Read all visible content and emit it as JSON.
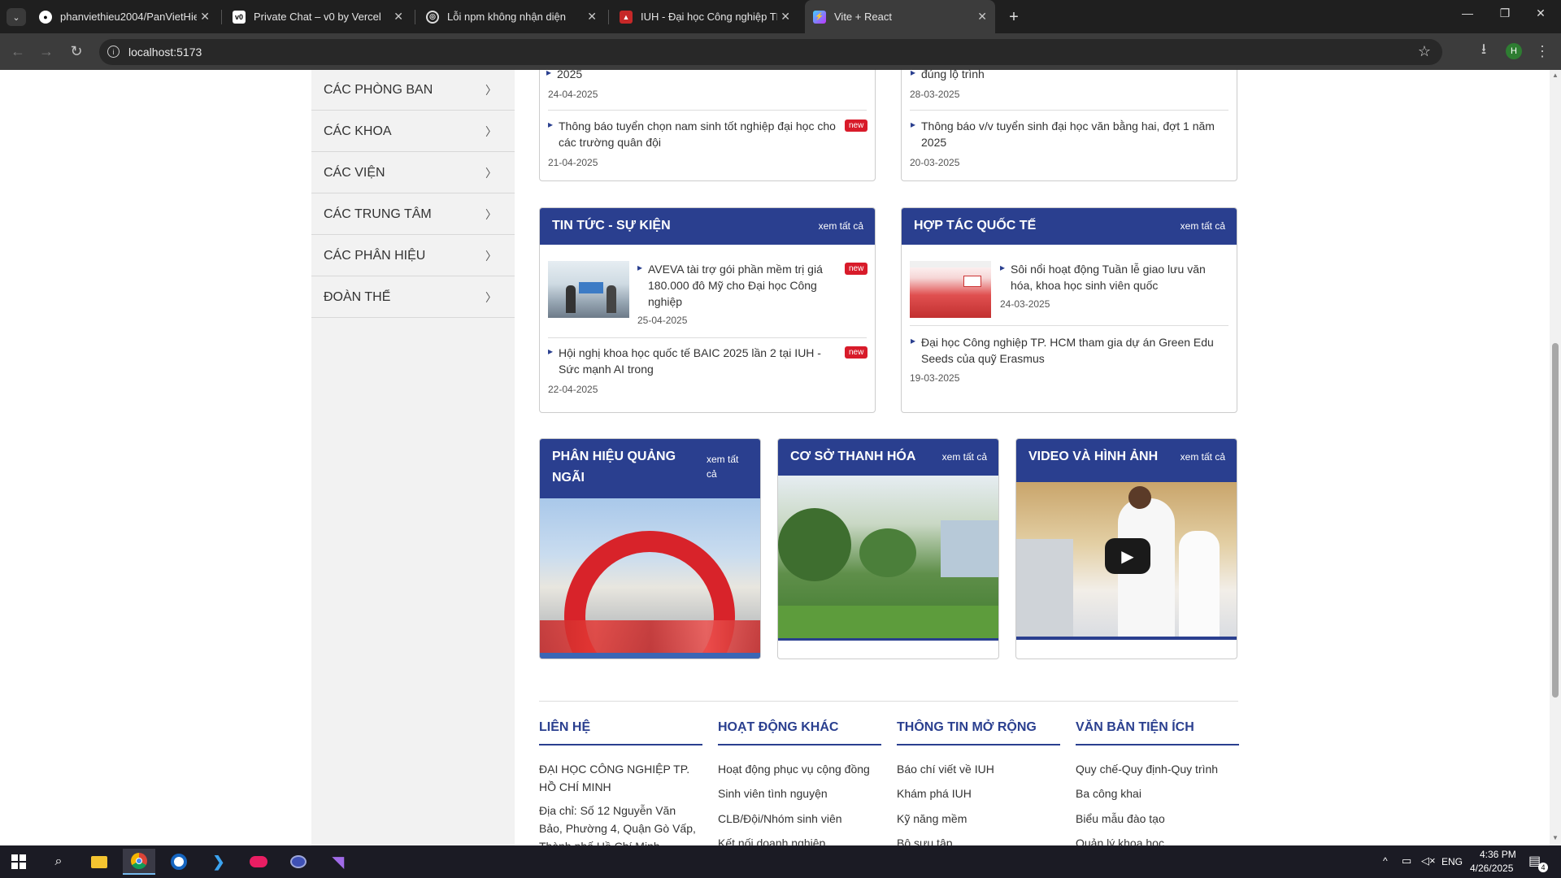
{
  "browser": {
    "tabs": [
      {
        "label": "phanviethieu2004/PanVietHie…",
        "icon": "github-icon"
      },
      {
        "label": "Private Chat – v0 by Vercel",
        "icon": "v0-icon"
      },
      {
        "label": "Lỗi npm không nhận diện",
        "icon": "chatgpt-icon"
      },
      {
        "label": "IUH - Đại học Công nghiệp TP.H…",
        "icon": "iuh-icon"
      },
      {
        "label": "Vite + React",
        "icon": "vite-icon"
      }
    ],
    "url": "localhost:5173",
    "profile_initial": "H"
  },
  "sidebar": {
    "items": [
      {
        "label": "CÁC PHÒNG BAN"
      },
      {
        "label": "CÁC KHOA"
      },
      {
        "label": "CÁC VIỆN"
      },
      {
        "label": "CÁC TRUNG TÂM"
      },
      {
        "label": "CÁC PHÂN HIỆU"
      },
      {
        "label": "ĐOÀN THỂ"
      }
    ]
  },
  "top_partial": {
    "left": {
      "cut_text": "2025",
      "date1": "24-04-2025",
      "item2_title": "Thông báo tuyển chọn nam sinh tốt nghiệp đại học cho các trường quân đội",
      "item2_date": "21-04-2025",
      "badge": "new"
    },
    "right": {
      "cut_text": "đúng lộ trình",
      "date1": "28-03-2025",
      "item2_title": "Thông báo v/v tuyển sinh đại học văn bằng hai, đợt 1 năm 2025",
      "item2_date": "20-03-2025"
    }
  },
  "news_events": {
    "title": "TIN TỨC - SỰ KIỆN",
    "more": "xem tất cả",
    "items": [
      {
        "title": "AVEVA tài trợ gói phần mềm trị giá 180.000 đô Mỹ cho Đại học Công nghiệp",
        "date": "25-04-2025",
        "badge": "new"
      },
      {
        "title": "Hội nghị khoa học quốc tế BAIC 2025 lần 2 tại IUH - Sức mạnh AI trong",
        "date": "22-04-2025",
        "badge": "new"
      }
    ]
  },
  "intl": {
    "title": "HỢP TÁC QUỐC TẾ",
    "more": "xem tất cả",
    "items": [
      {
        "title": "Sôi nổi hoạt động Tuần lễ giao lưu văn hóa, khoa học sinh viên quốc",
        "date": "24-03-2025"
      },
      {
        "title": "Đại học Công nghiệp TP. HCM tham gia dự án Green Edu Seeds của quỹ Erasmus",
        "date": "19-03-2025"
      }
    ]
  },
  "branches": [
    {
      "title": "PHÂN HIỆU QUẢNG NGÃI",
      "more": "xem tất cả"
    },
    {
      "title": "CƠ SỞ THANH HÓA",
      "more": "xem tất cả"
    },
    {
      "title": "VIDEO VÀ HÌNH ẢNH",
      "more": "xem tất cả"
    }
  ],
  "footer": {
    "contact": {
      "title": "LIÊN HỆ",
      "lines": [
        "ĐẠI HỌC CÔNG NGHIỆP TP. HỒ CHÍ MINH",
        "Địa chỉ: Số 12 Nguyễn Văn Bảo, Phường 4, Quận Gò Vấp, Thành phố Hồ Chí Minh"
      ]
    },
    "activities": {
      "title": "HOẠT ĐỘNG KHÁC",
      "links": [
        "Hoạt động phục vụ cộng đồng",
        "Sinh viên tình nguyện",
        "CLB/Đội/Nhóm sinh viên",
        "Kết nối doanh nghiệp"
      ]
    },
    "extended": {
      "title": "THÔNG TIN MỞ RỘNG",
      "links": [
        "Báo chí viết về IUH",
        "Khám phá IUH",
        "Kỹ năng mềm",
        "Bộ sưu tập"
      ]
    },
    "docs": {
      "title": "VĂN BẢN TIỆN ÍCH",
      "links": [
        "Quy chế-Quy định-Quy trình",
        "Ba công khai",
        "Biểu mẫu đào tạo",
        "Quản lý khoa học"
      ]
    }
  },
  "taskbar": {
    "lang": "ENG",
    "time": "4:36 PM",
    "date": "4/26/2025",
    "notif_count": "4"
  },
  "colors": {
    "brand": "#2a3f8f",
    "badge": "#d81b2a"
  }
}
